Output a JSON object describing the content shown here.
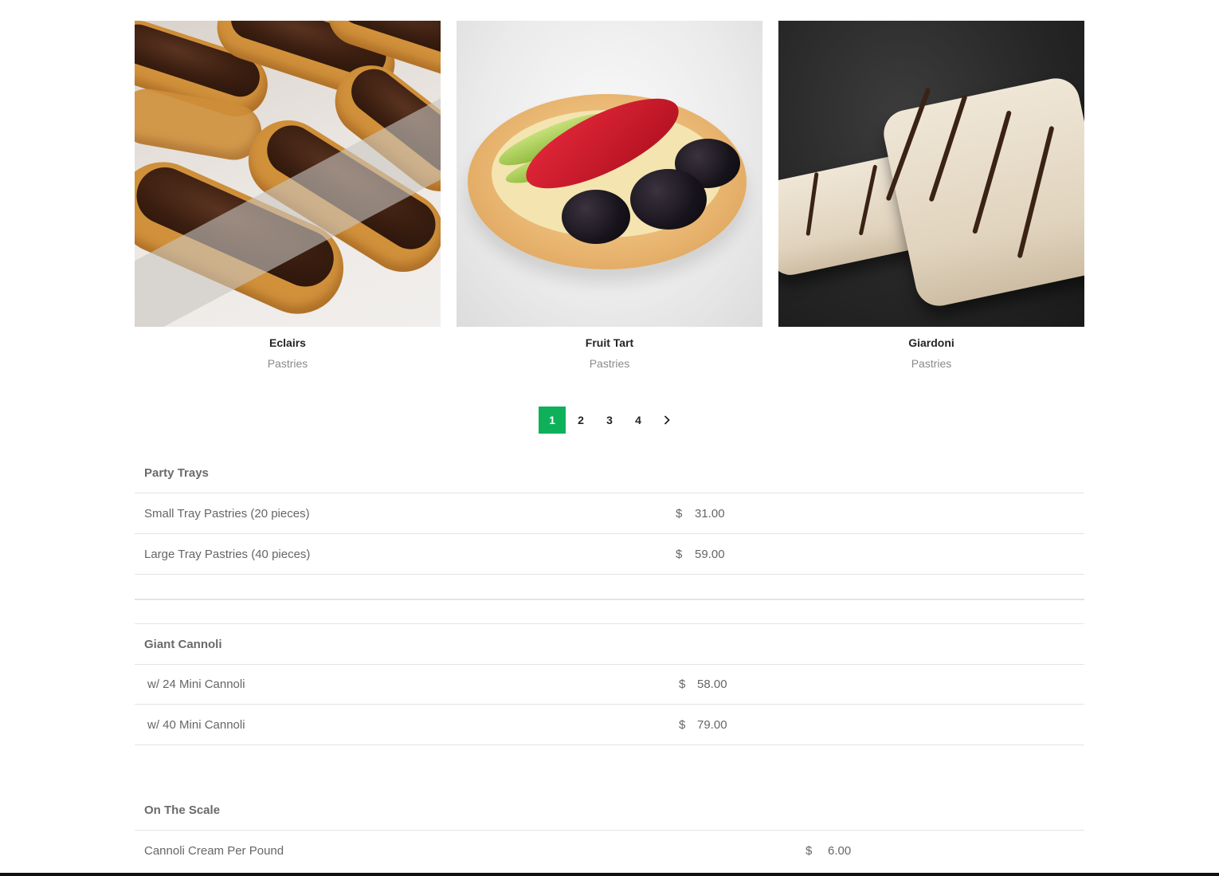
{
  "products": [
    {
      "name": "Eclairs",
      "category": "Pastries"
    },
    {
      "name": "Fruit Tart",
      "category": "Pastries"
    },
    {
      "name": "Giardoni",
      "category": "Pastries"
    }
  ],
  "pagination": {
    "pages": [
      "1",
      "2",
      "3",
      "4"
    ],
    "current": "1",
    "next_icon": "chevron-right-icon",
    "active_color": "#0fb05a"
  },
  "sections": {
    "party_trays": {
      "title": "Party Trays",
      "items": [
        {
          "name": "Small Tray Pastries (20 pieces)",
          "currency": "$",
          "price": "31.00"
        },
        {
          "name": "Large Tray Pastries (40 pieces)",
          "currency": "$",
          "price": "59.00"
        }
      ]
    },
    "giant_cannoli": {
      "title": "Giant Cannoli",
      "items": [
        {
          "name": " w/ 24 Mini Cannoli",
          "currency": "$",
          "price": "58.00"
        },
        {
          "name": " w/ 40 Mini Cannoli",
          "currency": "$",
          "price": "79.00"
        }
      ]
    },
    "on_the_scale": {
      "title": "On The Scale",
      "items": [
        {
          "name": "Cannoli Cream Per Pound",
          "currency": "$",
          "price": "6.00"
        }
      ]
    }
  }
}
